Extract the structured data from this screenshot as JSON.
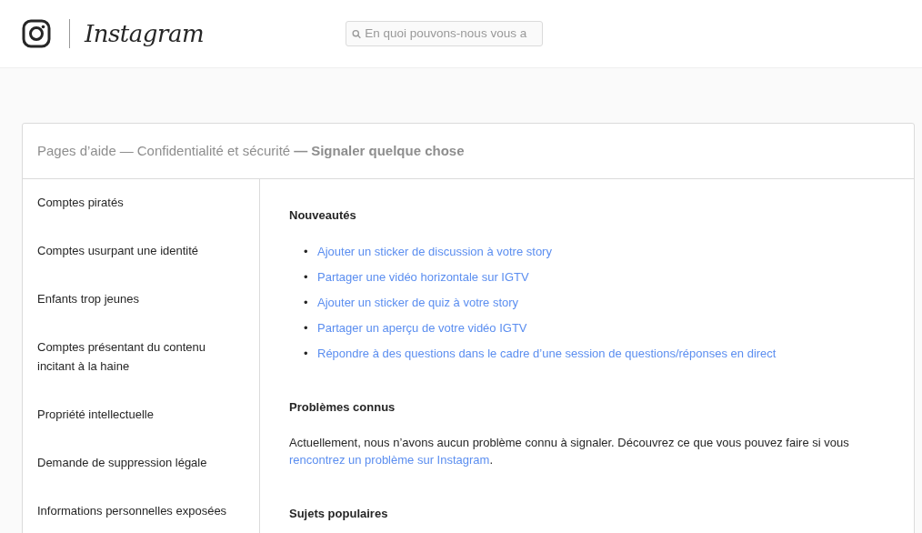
{
  "header": {
    "brand": "Instagram",
    "search": {
      "placeholder": "En quoi pouvons-nous vous a"
    }
  },
  "breadcrumb": {
    "separator": "—",
    "items": [
      {
        "label": "Pages d’aide",
        "current": false
      },
      {
        "label": "Confidentialité et sécurité",
        "current": false
      },
      {
        "label": "Signaler quelque chose",
        "current": true
      }
    ]
  },
  "sidebar": {
    "items": [
      {
        "label": "Comptes piratés"
      },
      {
        "label": "Comptes usurpant une identité"
      },
      {
        "label": "Enfants trop jeunes"
      },
      {
        "label": "Comptes présentant du contenu incitant à la haine"
      },
      {
        "label": "Propriété intellectuelle"
      },
      {
        "label": "Demande de suppression légale"
      },
      {
        "label": "Informations personnelles exposées"
      }
    ]
  },
  "sections": [
    {
      "kind": "links",
      "title": "Nouveautés",
      "bullet": "•",
      "links": [
        "Ajouter un sticker de discussion à votre story",
        "Partager une vidéo horizontale sur IGTV",
        "Ajouter un sticker de quiz à votre story",
        "Partager un aperçu de votre vidéo IGTV",
        "Répondre à des questions dans le cadre d’une session de questions/réponses en direct"
      ]
    },
    {
      "kind": "text",
      "title": "Problèmes connus",
      "text": "Actuellement, nous n’avons aucun problème connu à signaler. Découvrez ce que vous pouvez faire si vous ",
      "link": "rencontrez un problème sur Instagram",
      "after": "."
    },
    {
      "kind": "heading",
      "title": "Sujets populaires"
    }
  ]
}
